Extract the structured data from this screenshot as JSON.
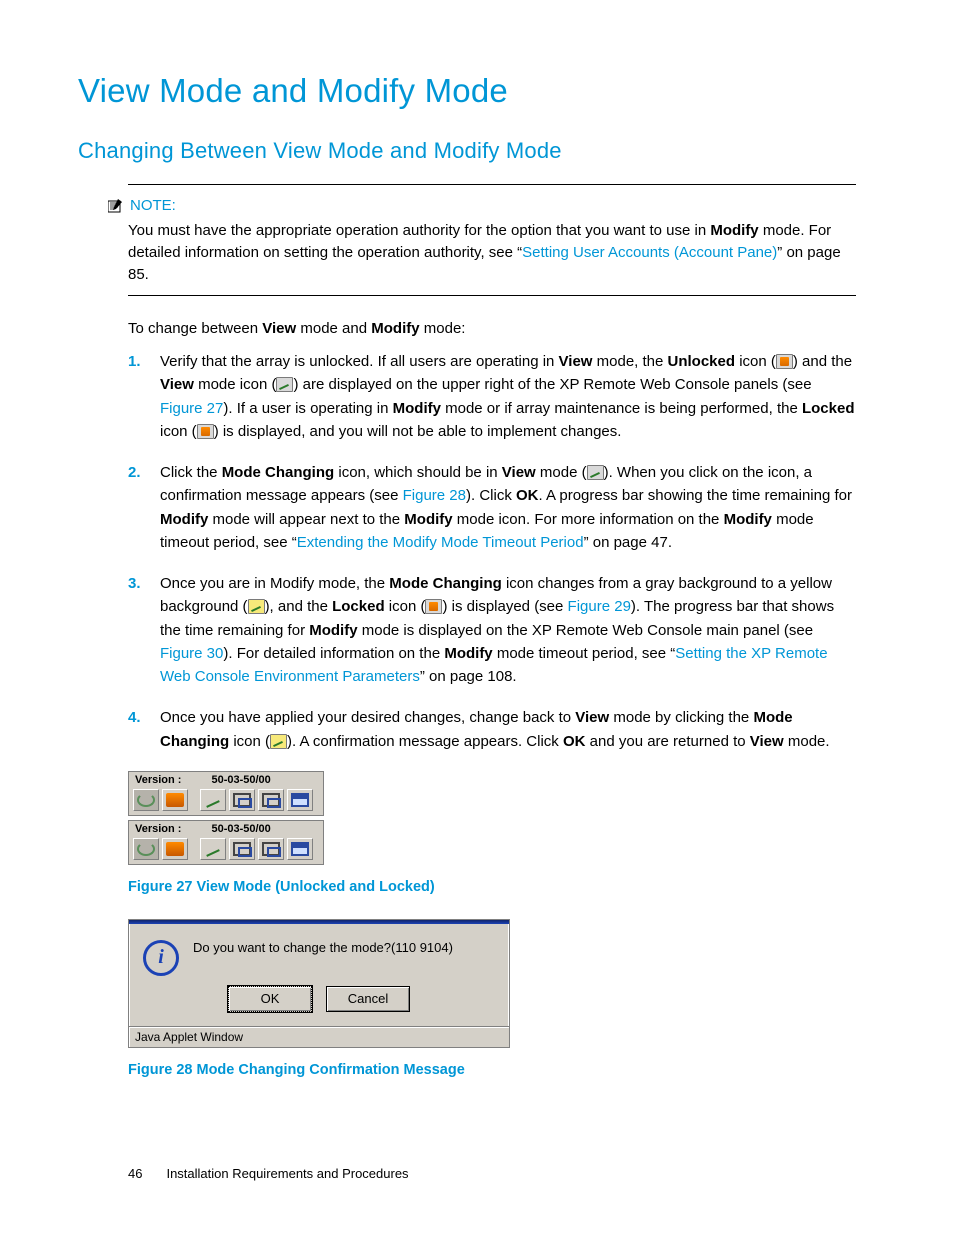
{
  "h1": "View Mode and Modify Mode",
  "h2": "Changing Between View Mode and Modify Mode",
  "note": {
    "label": "NOTE:",
    "pre": "You must have the appropriate operation authority for the option that you want to use in ",
    "modify": "Modify",
    "post1": " mode. For detailed information on setting the operation authority, see “",
    "link": "Setting User Accounts (Account Pane)",
    "post2": "” on page 85."
  },
  "intro": {
    "pre": "To change between ",
    "view": "View",
    "mid": " mode and ",
    "modify": "Modify",
    "post": " mode:"
  },
  "step1": {
    "a": "Verify that the array is unlocked. If all users are operating in ",
    "view": "View",
    "b": " mode, the ",
    "unlocked": "Unlocked",
    "c": " icon (",
    "d": ") and the ",
    "view2": "View",
    "e": " mode icon (",
    "f": ") are displayed on the upper right of the XP Remote Web Console panels (see ",
    "link1": "Figure 27",
    "g": "). If a user is operating in ",
    "modify": "Modify",
    "h": " mode or if array maintenance is being performed, the ",
    "locked": "Locked",
    "i": " icon (",
    "j": ") is displayed, and you will not be able to implement changes."
  },
  "step2": {
    "a": "Click the ",
    "mc": "Mode Changing",
    "b": " icon, which should be in ",
    "view": "View",
    "c": " mode (",
    "d": "). When you click on the icon, a confirmation message appears (see ",
    "link1": "Figure 28",
    "e": "). Click ",
    "ok": "OK",
    "f": ". A progress bar showing the time remaining for ",
    "modify": "Modify",
    "g": " mode will appear next to the ",
    "modify2": "Modify",
    "h": " mode icon. For more information on the ",
    "modify3": "Modify",
    "i": " mode timeout period, see “",
    "link2": "Extending the Modify Mode Timeout Period",
    "j": "” on page 47."
  },
  "step3": {
    "a": "Once you are in Modify mode, the ",
    "mc": "Mode Changing",
    "b": " icon changes from a gray background to a yellow background (",
    "c": "), and the ",
    "locked": "Locked",
    "d": " icon (",
    "e": ") is displayed (see ",
    "link1": "Figure 29",
    "f": "). The progress bar that shows the time remaining for ",
    "modify": "Modify",
    "g": " mode is displayed on the XP Remote Web Console main panel (see ",
    "link2": "Figure 30",
    "h": "). For detailed information on the ",
    "modify2": "Modify",
    "i": " mode timeout period, see “",
    "link3": "Setting the XP Remote Web Console Environment Parameters",
    "j": "” on page 108."
  },
  "step4": {
    "a": "Once you have applied your desired changes, change back to ",
    "view": "View",
    "b": " mode by clicking the ",
    "mc": "Mode Changing",
    "c": " icon (",
    "d": "). A confirmation message appears. Click ",
    "ok": "OK",
    "e": " and you are returned to ",
    "view2": "View",
    "f": " mode."
  },
  "toolbar": {
    "versionLabel": "Version :",
    "versionValue": "50-03-50/00"
  },
  "fig27_caption": "Figure 27 View Mode (Unlocked and Locked)",
  "dialog": {
    "msg": "Do you want to change the mode?(110 9104)",
    "ok": "OK",
    "cancel": "Cancel",
    "status": "Java Applet Window"
  },
  "fig28_caption": "Figure 28 Mode Changing Confirmation Message",
  "footer": {
    "page": "46",
    "title": "Installation Requirements and Procedures"
  }
}
